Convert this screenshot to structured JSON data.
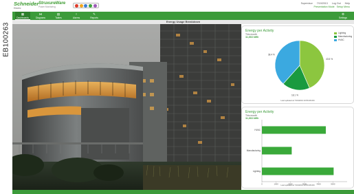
{
  "side_tag": "EB100263",
  "header": {
    "logo_name": "Schneider",
    "logo_sub": "Electric",
    "logo2_name": "StruxureWare",
    "logo2_sub": "Power Monitoring",
    "browser_colors": [
      "#e03b2b",
      "#f2a51a",
      "#3a7fd5",
      "#3aa63a",
      "#9b59b6"
    ],
    "user": "Supervisor",
    "date": "7/19/2013",
    "logout": "Log Out",
    "help": "Help",
    "presentation": "Presentation Mode",
    "setup": "Setup Menu"
  },
  "nav": {
    "items": [
      {
        "label": "Dashboards",
        "icon": "dashboards-icon",
        "glyph": "▦"
      },
      {
        "label": "Diagrams",
        "icon": "diagrams-icon",
        "glyph": "⋈"
      },
      {
        "label": "Tables",
        "icon": "tables-icon",
        "glyph": "▤"
      },
      {
        "label": "Alarms",
        "icon": "alarms-icon",
        "glyph": "!"
      },
      {
        "label": "Reports",
        "icon": "reports-icon",
        "glyph": "✎"
      }
    ],
    "settings_label": "Settings",
    "settings_glyph": "⚙"
  },
  "page_title": "Energy Usage Breakdown",
  "colors": {
    "accent": "#3c9b3a",
    "lighting": "#8cc63f",
    "manufacturing": "#1a9a3f",
    "hvac": "#3ba9e0",
    "bar": "#3aa93a"
  },
  "panel_pie": {
    "title": "Energy per Activity",
    "subtitle": "This month",
    "total": "11,663 kWh",
    "footer": "Last updated at 7/19/2013 10:59:48 AM"
  },
  "panel_bar": {
    "title": "Energy per Activity",
    "subtitle": "This month",
    "total": "11,663 kWh",
    "footer": "Last updated at 7/19/2013 10:59:48 AM"
  },
  "chart_data": [
    {
      "type": "pie",
      "categories": [
        "Lighting",
        "Manufacturing",
        "HVAC"
      ],
      "values": [
        43.5,
        18.1,
        38.4
      ],
      "labels": [
        "43.5 %",
        "18.1 %",
        "38.4 %"
      ],
      "legend": "top-right"
    },
    {
      "type": "bar",
      "orientation": "horizontal",
      "categories": [
        "HVAC",
        "Manufacturing",
        "Lighting"
      ],
      "values": [
        4500,
        2100,
        5050
      ],
      "xlim": [
        0,
        6000
      ],
      "xticks": [
        "0",
        "1000",
        "2000",
        "3000",
        "4000",
        "5000"
      ]
    }
  ]
}
